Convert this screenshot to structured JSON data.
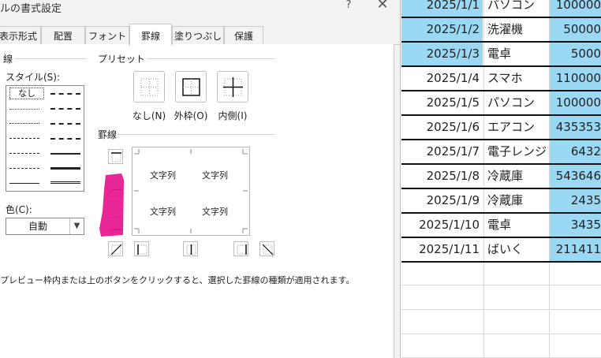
{
  "dialog": {
    "title": "ルの書式設定",
    "help_label": "?",
    "close_label": "✕",
    "tabs": [
      {
        "label": "表示形式",
        "active": false
      },
      {
        "label": "配置",
        "active": false
      },
      {
        "label": "フォント",
        "active": false
      },
      {
        "label": "罫線",
        "active": true
      },
      {
        "label": "塗りつぶし",
        "active": false
      },
      {
        "label": "保護",
        "active": false
      }
    ],
    "line_group": {
      "title": "線",
      "style_label": "スタイル(S):",
      "none_label": "なし",
      "color_label": "色(C):",
      "color_value": "自動"
    },
    "presets": {
      "title": "プリセット",
      "items": [
        {
          "label": "なし(N)",
          "icon": "border-none-icon"
        },
        {
          "label": "外枠(O)",
          "icon": "border-outline-icon"
        },
        {
          "label": "内側(I)",
          "icon": "border-inside-icon"
        }
      ]
    },
    "border": {
      "title": "罫線",
      "preview_texts": [
        "文字列",
        "文字列",
        "文字列",
        "文字列"
      ],
      "highlight_color": "#e6138c"
    },
    "help_text": "プレビュー枠内または上のボタンをクリックすると、選択した罫線の種類が適用されます。"
  },
  "sheet": {
    "accent_color": "#9bd8f3",
    "rows": [
      {
        "date": "2025/1/1",
        "item": "パソコン",
        "amount": "100000"
      },
      {
        "date": "2025/1/2",
        "item": "洗濯機",
        "amount": "50000"
      },
      {
        "date": "2025/1/3",
        "item": "電卓",
        "amount": "5000"
      },
      {
        "date": "2025/1/4",
        "item": "スマホ",
        "amount": "110000"
      },
      {
        "date": "2025/1/5",
        "item": "パソコン",
        "amount": "100000"
      },
      {
        "date": "2025/1/6",
        "item": "エアコン",
        "amount": "435353"
      },
      {
        "date": "2025/1/7",
        "item": "電子レンジ",
        "amount": "6432"
      },
      {
        "date": "2025/1/8",
        "item": "冷蔵庫",
        "amount": "543646"
      },
      {
        "date": "2025/1/9",
        "item": "冷蔵庫",
        "amount": "2435"
      },
      {
        "date": "2025/1/10",
        "item": "電卓",
        "amount": "3435"
      },
      {
        "date": "2025/1/11",
        "item": "ばいく",
        "amount": "211411"
      }
    ]
  }
}
